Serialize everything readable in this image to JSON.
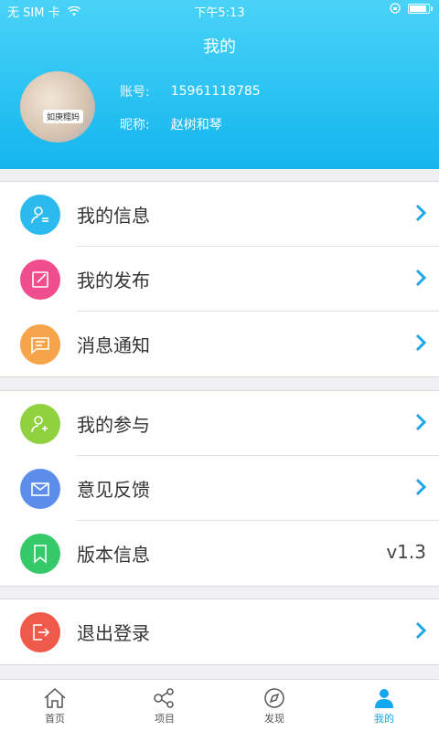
{
  "status": {
    "carrier": "无 SIM 卡",
    "wifi_icon": "wifi-icon",
    "time": "下午5:13",
    "lock_icon": "rotation-lock-icon",
    "battery_icon": "battery-icon"
  },
  "header": {
    "title": "我的",
    "account_label": "账号:",
    "account_value": "15961118785",
    "nickname_label": "昵称:",
    "nickname_value": "赵树和琴",
    "avatar_tag": "如庚糯妈"
  },
  "groups": [
    {
      "items": [
        {
          "label": "我的信息",
          "icon": "user-info-icon",
          "color": "#2bb9ee"
        },
        {
          "label": "我的发布",
          "icon": "edit-icon",
          "color": "#f04d8f"
        },
        {
          "label": "消息通知",
          "icon": "message-icon",
          "color": "#f6a449"
        }
      ]
    },
    {
      "items": [
        {
          "label": "我的参与",
          "icon": "user-add-icon",
          "color": "#8fd13e"
        },
        {
          "label": "意见反馈",
          "icon": "mail-icon",
          "color": "#5c8dea"
        },
        {
          "label": "版本信息",
          "icon": "bookmark-icon",
          "color": "#35c96a",
          "value": "v1.3"
        }
      ]
    },
    {
      "items": [
        {
          "label": "退出登录",
          "icon": "logout-icon",
          "color": "#ef5a4b"
        }
      ]
    }
  ],
  "tabbar": [
    {
      "label": "首页",
      "icon": "home-icon"
    },
    {
      "label": "项目",
      "icon": "share-nodes-icon"
    },
    {
      "label": "发现",
      "icon": "compass-icon"
    },
    {
      "label": "我的",
      "icon": "person-icon",
      "active": true
    }
  ],
  "colors": {
    "accent": "#12a8ef",
    "chevron": "#1aa7e8"
  }
}
